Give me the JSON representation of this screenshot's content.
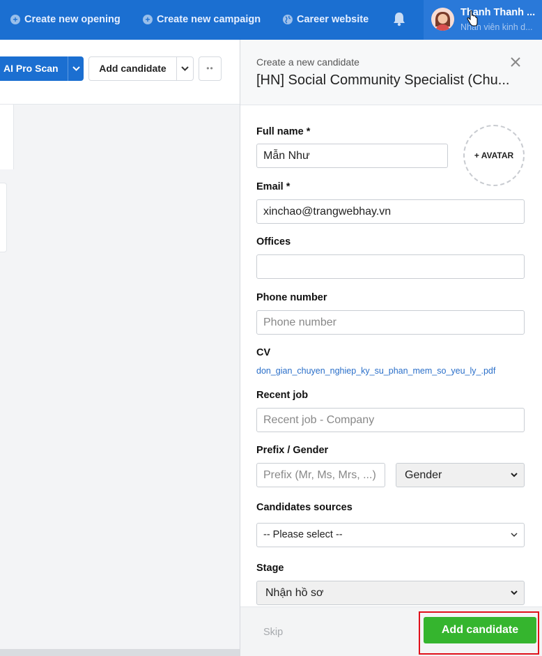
{
  "topbar": {
    "nav": [
      {
        "label": "Create new opening",
        "icon": "plus-circle-icon"
      },
      {
        "label": "Create new campaign",
        "icon": "plus-circle-icon"
      },
      {
        "label": "Career website",
        "icon": "globe-icon"
      }
    ],
    "user": {
      "name": "Thanh Thanh ...",
      "role": "Nhân viên kinh d..."
    }
  },
  "toolbar": {
    "ai_scan_label": "AI Pro Scan",
    "add_candidate_label": "Add candidate",
    "more_label": "••"
  },
  "drawer": {
    "subtitle": "Create a new candidate",
    "title": "[HN] Social Community Specialist (Chu...",
    "avatar_label": "+ AVATAR",
    "fields": {
      "full_name": {
        "label": "Full name *",
        "value": "Mẫn Như"
      },
      "email": {
        "label": "Email *",
        "value": "xinchao@trangwebhay.vn"
      },
      "offices": {
        "label": "Offices",
        "value": ""
      },
      "phone": {
        "label": "Phone number",
        "placeholder": "Phone number"
      },
      "cv": {
        "label": "CV",
        "file": "don_gian_chuyen_nghiep_ky_su_phan_mem_so_yeu_ly_.pdf"
      },
      "recent_job": {
        "label": "Recent job",
        "placeholder": "Recent job - Company"
      },
      "prefix_gender": {
        "label": "Prefix / Gender",
        "prefix_placeholder": "Prefix (Mr, Ms, Mrs, ...)",
        "gender_value": "Gender"
      },
      "sources": {
        "label": "Candidates sources",
        "value": "-- Please select --"
      },
      "stage": {
        "label": "Stage",
        "value": "Nhận hồ sơ"
      }
    },
    "footer": {
      "skip_label": "Skip",
      "submit_label": "Add candidate"
    }
  },
  "colors": {
    "brand_blue": "#1b6fd1",
    "submit_green": "#35b52e",
    "highlight_red": "#e0101a"
  }
}
